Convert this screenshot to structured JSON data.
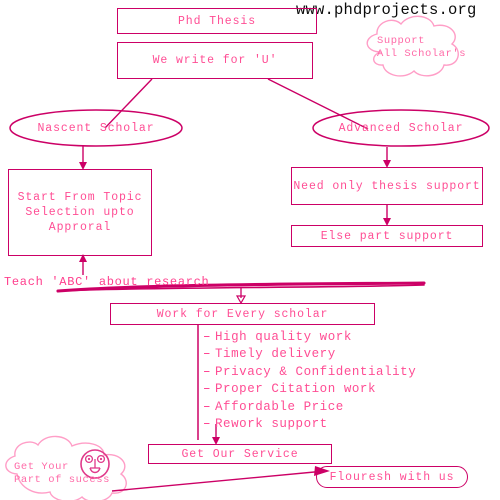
{
  "page": {
    "site_url": "www.phdprojects.org",
    "accent_border": "#cc0066",
    "accent_text": "#ff4d94",
    "cloud_stroke": "#ff9ec7",
    "background": "#ffffff"
  },
  "nodes": {
    "title_box": "Phd Thesis",
    "tagline_box": "We write for 'U'",
    "left_branch": "Nascent Scholar",
    "right_branch": "Advanced Scholar",
    "left_detail": "Start From Topic\nSelection upto\nApproral",
    "right_detail_1": "Need only thesis support",
    "right_detail_2": "Else part support",
    "teach_line": "Teach 'ABC' about research",
    "work_box": "Work for Every scholar",
    "service_box": "Get Our Service",
    "flourish_box": "Flouresh with us"
  },
  "clouds": {
    "support": "Support\nAll Scholar's",
    "success": "Get Your\nPart of sucess"
  },
  "bullets": [
    "High quality work",
    "Timely delivery",
    "Privacy & Confidentiality",
    "Proper Citation work",
    "Affordable Price",
    "Rework support"
  ],
  "icons": {
    "smiley": "smiley-face-icon",
    "cloud_support": "cloud-icon",
    "cloud_success": "cloud-icon"
  }
}
